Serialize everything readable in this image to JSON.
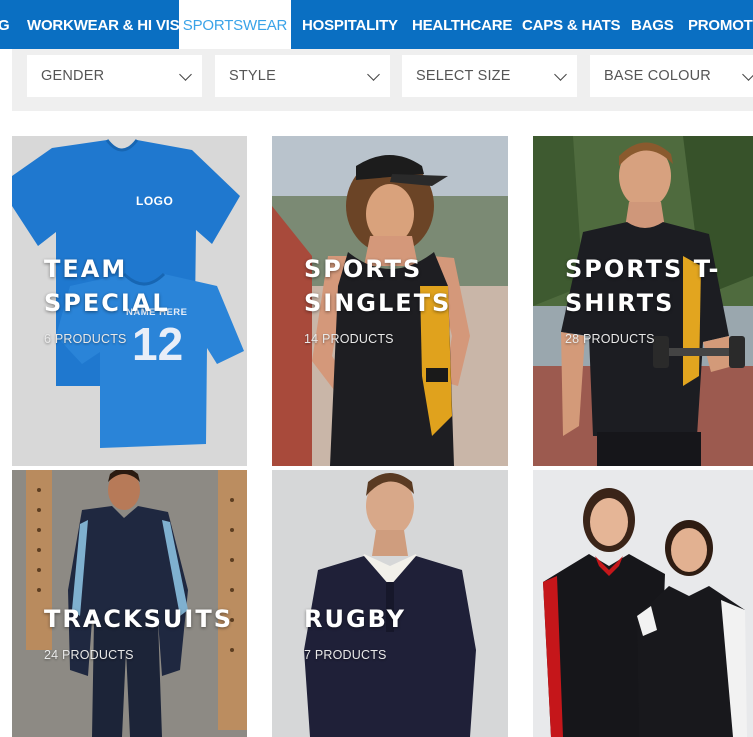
{
  "nav": {
    "items": [
      {
        "label": "G"
      },
      {
        "label": "WORKWEAR & HI VIS"
      },
      {
        "label": "SPORTSWEAR"
      },
      {
        "label": "HOSPITALITY"
      },
      {
        "label": "HEALTHCARE"
      },
      {
        "label": "CAPS & HATS"
      },
      {
        "label": "BAGS"
      },
      {
        "label": "PROMOTI"
      }
    ],
    "active": "SPORTSWEAR"
  },
  "filters": [
    {
      "label": "GENDER"
    },
    {
      "label": "STYLE"
    },
    {
      "label": "SELECT SIZE"
    },
    {
      "label": "BASE COLOUR"
    }
  ],
  "categories": [
    {
      "title_line1": "TEAM",
      "title_line2": "SPECIAL",
      "count": "6 PRODUCTS",
      "shirt_text_logo": "LOGO",
      "shirt_text_name": "NAME HERE",
      "shirt_number": "12"
    },
    {
      "title_line1": "SPORTS",
      "title_line2": "SINGLETS",
      "count": "14 PRODUCTS"
    },
    {
      "title_line1": "SPORTS T-",
      "title_line2": "SHIRTS",
      "count": "28 PRODUCTS"
    },
    {
      "title_line1": "TRACKSUITS",
      "count": "24 PRODUCTS"
    },
    {
      "title_line1": "RUGBY",
      "count": "7 PRODUCTS"
    },
    {
      "title_line1": "",
      "count": ""
    }
  ],
  "colors": {
    "nav_bg": "#0a6fc2",
    "nav_active_text": "#3aa3e8",
    "filter_bar_bg": "#efefef"
  }
}
